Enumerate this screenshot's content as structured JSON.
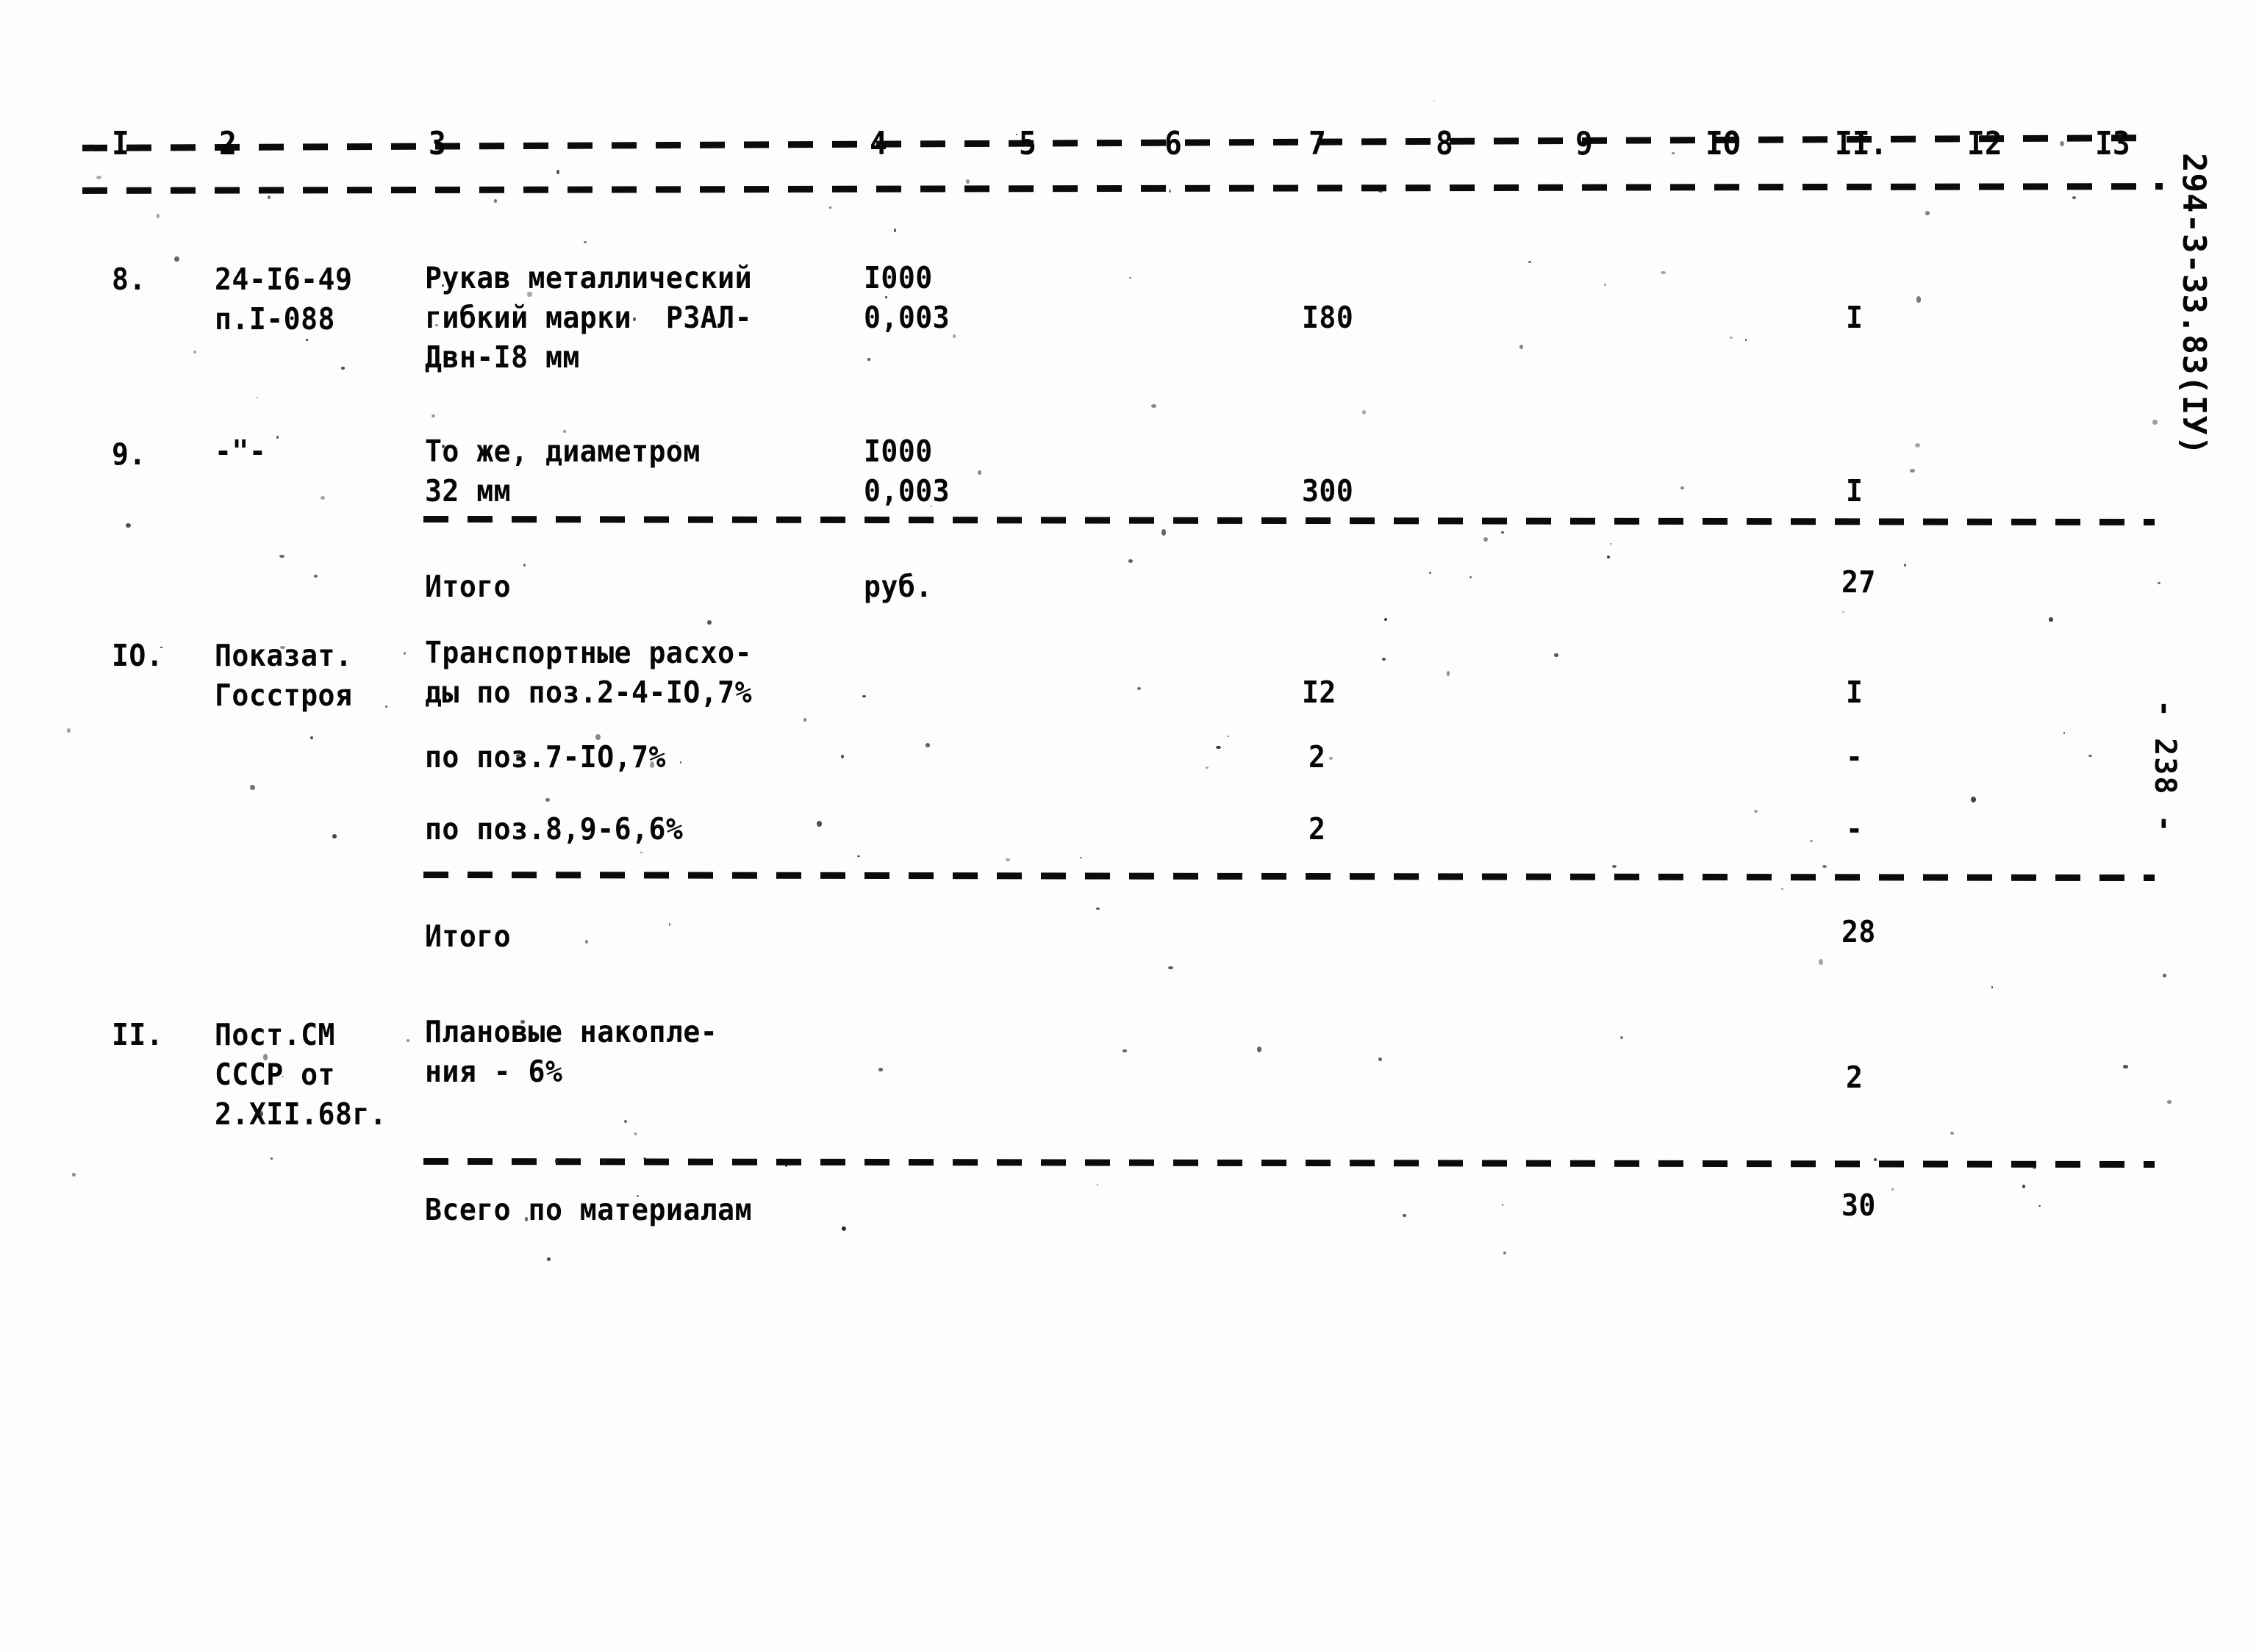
{
  "document": {
    "side_code": "294-3-33.83(IУ)",
    "page_marker": "- 238 -"
  },
  "table": {
    "column_headers": [
      "I",
      "2",
      "3",
      "4",
      "5",
      "6",
      "7",
      "8",
      "9",
      "IO",
      "II.",
      "I2",
      "I3"
    ],
    "rows": [
      {
        "kind": "item",
        "col1": "8.",
        "col2_lines": [
          "24-I6-49",
          "п.I-088"
        ],
        "col3_lines": [
          "Рукав металлический",
          "гибкий марки  РЗАЛ-",
          "Двн-I8 мм"
        ],
        "col4_lines": [
          "I000",
          "0,003"
        ],
        "col7": "I80",
        "col11": "I"
      },
      {
        "kind": "item",
        "col1": "9.",
        "col2_lines": [
          "-\"-"
        ],
        "col3_lines": [
          "То же, диаметром",
          "32 мм"
        ],
        "col4_lines": [
          "I000",
          "0,003"
        ],
        "col7": "300",
        "col11": "I"
      },
      {
        "kind": "total",
        "col3_lines": [
          "Итого"
        ],
        "col4_lines": [
          "руб."
        ],
        "col11": "27"
      },
      {
        "kind": "item",
        "col1": "IO.",
        "col2_lines": [
          "Показат.",
          "Госстроя"
        ],
        "col3_lines": [
          "Транспортные расхо-",
          "ды по поз.2-4-IO,7%"
        ],
        "col7": "I2",
        "col11": "I"
      },
      {
        "kind": "sub",
        "col3_lines": [
          "по поз.7-IO,7%"
        ],
        "col7": "2",
        "col11": "-"
      },
      {
        "kind": "sub",
        "col3_lines": [
          "по поз.8,9-6,6%"
        ],
        "col7": "2",
        "col11": "-"
      },
      {
        "kind": "total",
        "col3_lines": [
          "Итого"
        ],
        "col11": "28"
      },
      {
        "kind": "item",
        "col1": "II.",
        "col2_lines": [
          "Пост.СМ",
          "СССР от",
          "2.XII.68г."
        ],
        "col3_lines": [
          "Плановые накопле-",
          "ния - 6%"
        ],
        "col11": "2"
      },
      {
        "kind": "total",
        "col3_lines": [
          "Всего по материалам"
        ],
        "col11": "30"
      }
    ]
  }
}
